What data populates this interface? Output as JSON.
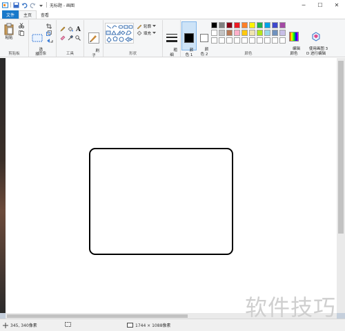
{
  "window": {
    "title": "无标题 - 画图",
    "minimize": "─",
    "maximize": "☐",
    "close": "✕"
  },
  "tabs": [
    {
      "label": "文件"
    },
    {
      "label": "主页"
    },
    {
      "label": "查看"
    }
  ],
  "ribbon": {
    "clipboard": {
      "paste": "粘贴",
      "group": "剪贴板"
    },
    "image": {
      "select": "选\n择",
      "group": "图像"
    },
    "tools": {
      "group": "工具"
    },
    "brushes": {
      "label": "刷\n子"
    },
    "shapes": {
      "outline": "轮廓",
      "fill": "填充",
      "group": "形状"
    },
    "size": {
      "label": "粗\n细"
    },
    "color1": {
      "label": "颜\n色 1",
      "value": "#000000"
    },
    "color2": {
      "label": "颜\n色 2",
      "value": "#ffffff"
    },
    "edit_colors": {
      "label": "编辑\n颜色"
    },
    "paint3d": {
      "label": "使用画图 3\nD 进行编辑"
    },
    "colors_group": "颜色",
    "palette": [
      [
        "#000000",
        "#7f7f7f",
        "#880015",
        "#ed1c24",
        "#ff7f27",
        "#fff200",
        "#22b14c",
        "#00a2e8",
        "#3f48cc",
        "#a349a4"
      ],
      [
        "#ffffff",
        "#c3c3c3",
        "#b97a57",
        "#ffaec9",
        "#ffc90e",
        "#efe4b0",
        "#b5e61d",
        "#99d9ea",
        "#7092be",
        "#c8bfe7"
      ],
      [
        "#ffffff",
        "#ffffff",
        "#ffffff",
        "#ffffff",
        "#ffffff",
        "#ffffff",
        "#ffffff",
        "#ffffff",
        "#ffffff",
        "#ffffff"
      ]
    ]
  },
  "status": {
    "cursor": "345, 340像素",
    "selection": "",
    "canvas_size": "1744 × 1088像素"
  },
  "watermark": "软件技巧"
}
